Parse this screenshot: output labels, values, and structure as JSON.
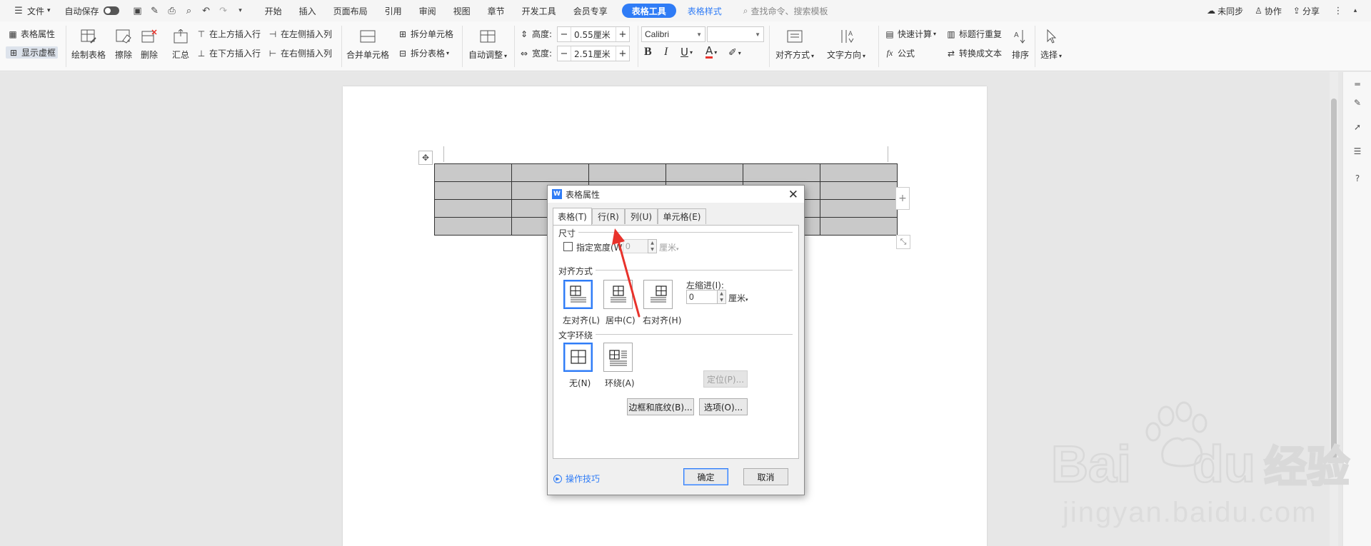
{
  "menubar": {
    "menu_label": "文件",
    "autosave_label": "自动保存",
    "tabs": [
      "开始",
      "插入",
      "页面布局",
      "引用",
      "审阅",
      "视图",
      "章节",
      "开发工具",
      "会员专享"
    ],
    "active_tab": "表格工具",
    "context_tab": "表格样式",
    "search_placeholder": "查找命令、搜索模板",
    "sync_label": "未同步",
    "collab_label": "协作",
    "share_label": "分享"
  },
  "ribbon": {
    "table_props": "表格属性",
    "show_gridlines": "显示虚框",
    "draw_table": "绘制表格",
    "erase": "擦除",
    "delete": "删除",
    "summary": "汇总",
    "insert_above": "在上方插入行",
    "insert_below": "在下方插入行",
    "insert_left": "在左侧插入列",
    "insert_right": "在右侧插入列",
    "merge_cells": "合并单元格",
    "split_cells": "拆分单元格",
    "split_table": "拆分表格",
    "auto_fit": "自动调整",
    "height_label": "高度:",
    "height_value": "0.55厘米",
    "width_label": "宽度:",
    "width_value": "2.51厘米",
    "font_name": "Calibri",
    "font_size": "",
    "bold": "B",
    "italic": "I",
    "underline": "U",
    "font_color": "A",
    "align": "对齐方式",
    "text_direction": "文字方向",
    "quick_calc": "快速计算",
    "formula": "公式",
    "repeat_header": "标题行重复",
    "to_text": "转换成文本",
    "sort": "排序",
    "select": "选择"
  },
  "document": {
    "table_rows": 4,
    "table_cols": 6
  },
  "dialog": {
    "title": "表格属性",
    "tabs": [
      "表格(T)",
      "行(R)",
      "列(U)",
      "单元格(E)"
    ],
    "section_size": "尺寸",
    "specify_width": "指定宽度(W):",
    "width_value": "0",
    "width_unit": "厘米",
    "section_align": "对齐方式",
    "align_left": "左对齐(L)",
    "align_center": "居中(C)",
    "align_right": "右对齐(H)",
    "indent_label": "左缩进(I):",
    "indent_value": "0",
    "indent_unit": "厘米",
    "section_wrap": "文字环绕",
    "wrap_none": "无(N)",
    "wrap_around": "环绕(A)",
    "position_btn": "定位(P)...",
    "borders_btn": "边框和底纹(B)...",
    "options_btn": "选项(O)...",
    "tips": "操作技巧",
    "ok": "确定",
    "cancel": "取消"
  },
  "colors": {
    "accent": "#2f7cf6",
    "annotation_arrow": "#e8322b",
    "cell_fill": "#c9c9c9"
  }
}
